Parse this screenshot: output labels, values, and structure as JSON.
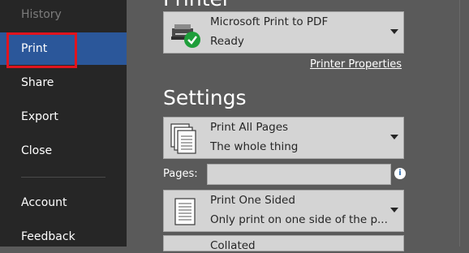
{
  "sidebar": {
    "items": [
      {
        "label": "History",
        "state": "dimmed"
      },
      {
        "label": "Print",
        "state": "active"
      },
      {
        "label": "Share"
      },
      {
        "label": "Export"
      },
      {
        "label": "Close"
      },
      {
        "label": "Account"
      },
      {
        "label": "Feedback"
      }
    ],
    "accent_color": "#2b579a",
    "highlight_color": "#e0141e"
  },
  "printer": {
    "heading": "Printer",
    "name": "Microsoft Print to PDF",
    "status": "Ready",
    "icon": "printer-ready-icon",
    "properties_link": "Printer Properties"
  },
  "settings": {
    "heading": "Settings",
    "range": {
      "label": "Print All Pages",
      "description": "The whole thing",
      "icon": "pages-stack-icon"
    },
    "pages_label": "Pages:",
    "pages_value": "",
    "sides": {
      "label": "Print One Sided",
      "description": "Only print on one side of the p...",
      "icon": "single-page-icon"
    },
    "collation": {
      "label": "Collated"
    }
  }
}
